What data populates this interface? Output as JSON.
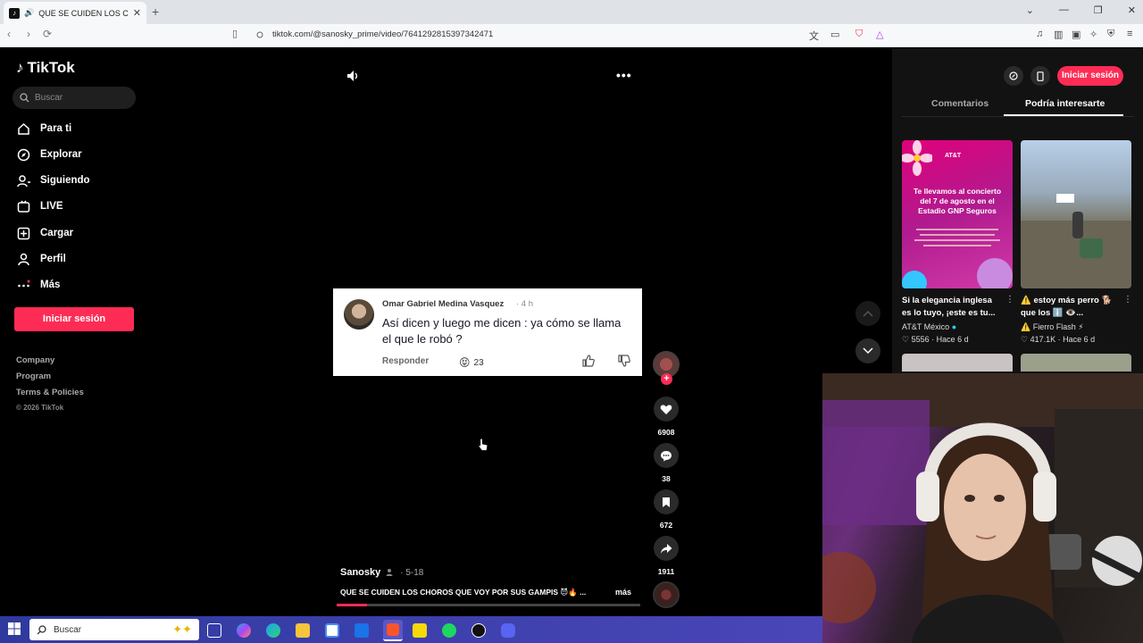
{
  "browser": {
    "tab_title": "QUE SE CUIDEN LOS CHOROS",
    "tab_close": "✕",
    "new_tab": "+",
    "url": "tiktok.com/@sanosky_prime/video/7641292815397342471"
  },
  "sidebar": {
    "logo": "TikTok",
    "search_placeholder": "Buscar",
    "items": [
      {
        "label": "Para ti",
        "icon": "home-icon"
      },
      {
        "label": "Explorar",
        "icon": "compass-icon"
      },
      {
        "label": "Siguiendo",
        "icon": "following-icon"
      },
      {
        "label": "LIVE",
        "icon": "live-icon"
      },
      {
        "label": "Cargar",
        "icon": "upload-icon"
      },
      {
        "label": "Perfil",
        "icon": "profile-icon"
      },
      {
        "label": "Más",
        "icon": "more-icon"
      }
    ],
    "login_label": "Iniciar sesión",
    "footer": [
      "Company",
      "Program",
      "Terms & Policies"
    ],
    "copyright": "© 2026 TikTok"
  },
  "comment": {
    "author": "Omar Gabriel Medina Vasquez",
    "time": "· 4 h",
    "text": "Así dicen y luego me dicen : ya cómo se llama el que le robó ?",
    "reply": "Responder",
    "reaction_emoji": "😝",
    "reaction_count": "23"
  },
  "actions": {
    "likes": "6908",
    "comments": "38",
    "saves": "672",
    "shares": "1911"
  },
  "video": {
    "author": "Sanosky",
    "date": "· 5-18",
    "caption": "QUE SE CUIDEN LOS CHOROS QUE VOY POR SUS GAMPIS 😈🔥 ...",
    "more": "más",
    "progress_percent": 10
  },
  "right_panel": {
    "login_label": "Iniciar sesión",
    "tabs": [
      "Comentarios",
      "Podría interesarte"
    ],
    "videos": [
      {
        "title": "Si la elegancia inglesa es lo tuyo, ¡este es tu...",
        "account": "AT&T México",
        "likes": "♡ 5556",
        "ago": "· Hace 6 d",
        "thumb_heading": "Te llevamos al concierto del 7 de agosto en el Estadio GNP Seguros",
        "thumb_brand": "AT&T"
      },
      {
        "title": "⚠️ estoy más perro 🐕 que los ℹ️ 👁️...",
        "account": "⚠️ Fierro Flash ⚡",
        "likes": "♡ 417.1K",
        "ago": "· Hace 6 d"
      }
    ]
  },
  "taskbar": {
    "search_label": "Buscar"
  },
  "colors": {
    "accent": "#fe2c55",
    "background": "#000000",
    "panel": "#121212"
  }
}
